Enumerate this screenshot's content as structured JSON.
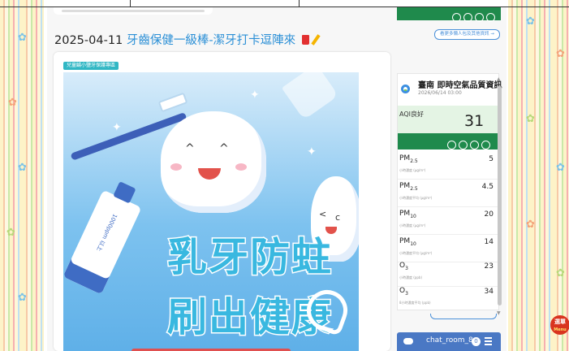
{
  "post": {
    "date": "2025-04-11",
    "title": "牙齒保健一級棒-潔牙打卡逗陣來",
    "tag": "兒童齲小鹽牙保護專區"
  },
  "poster": {
    "headline_line1": "乳牙防蛀",
    "headline_line2": "刷出健康",
    "toothpaste_label": "1000ppm 以上"
  },
  "sidebar": {
    "more_link": "看更多懶人包及其他資訊 →",
    "aqi": {
      "title": "臺南 即時空氣品質資訊",
      "time": "2026/06/14 03:00",
      "status": "AQI良好",
      "value": "31",
      "pollutants": [
        {
          "name": "PM",
          "sub": "2.5",
          "unit": "小時濃度 (μg/m³)",
          "value": "5"
        },
        {
          "name": "PM",
          "sub": "2.5",
          "unit": "小時濃度平均 (μg/m³)",
          "value": "4.5"
        },
        {
          "name": "PM",
          "sub": "10",
          "unit": "小時濃度 (μg/m³)",
          "value": "20"
        },
        {
          "name": "PM",
          "sub": "10",
          "unit": "小時濃度平均 (μg/m³)",
          "value": "14"
        },
        {
          "name": "O",
          "sub": "3",
          "unit": "小時濃度 (ppb)",
          "value": "23"
        },
        {
          "name": "O",
          "sub": "3",
          "unit": "8小時濃度平均 (ppb)",
          "value": "34"
        }
      ]
    },
    "chat": {
      "name": "chat_room_8",
      "badge": "0"
    }
  },
  "menu_button": {
    "label": "選單",
    "sub": "Menu"
  },
  "colors": {
    "accent_green": "#1f8a4c",
    "link_blue": "#2a8fd6",
    "poster_blue": "#39b8e0"
  }
}
